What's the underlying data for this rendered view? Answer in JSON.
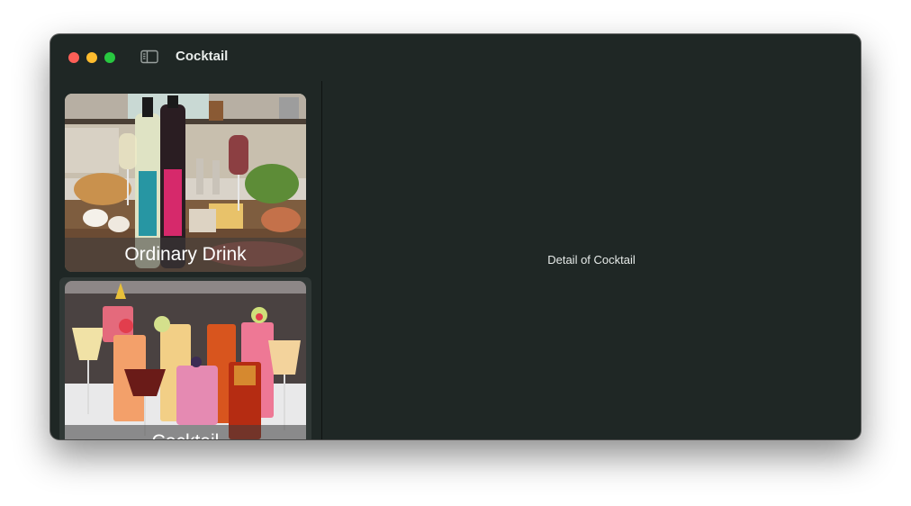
{
  "window": {
    "title": "Cocktail"
  },
  "sidebar": {
    "items": [
      {
        "label": "Ordinary Drink",
        "image": "wine-bottles-food-photo"
      },
      {
        "label": "Cocktail",
        "image": "cocktail-glasses-photo"
      }
    ]
  },
  "detail": {
    "text": "Detail of Cocktail"
  },
  "colors": {
    "window_bg": "#1f2725",
    "selected_bg": "#303836",
    "close": "#fe5f57",
    "minimize": "#febc2e",
    "zoom": "#28c840"
  }
}
